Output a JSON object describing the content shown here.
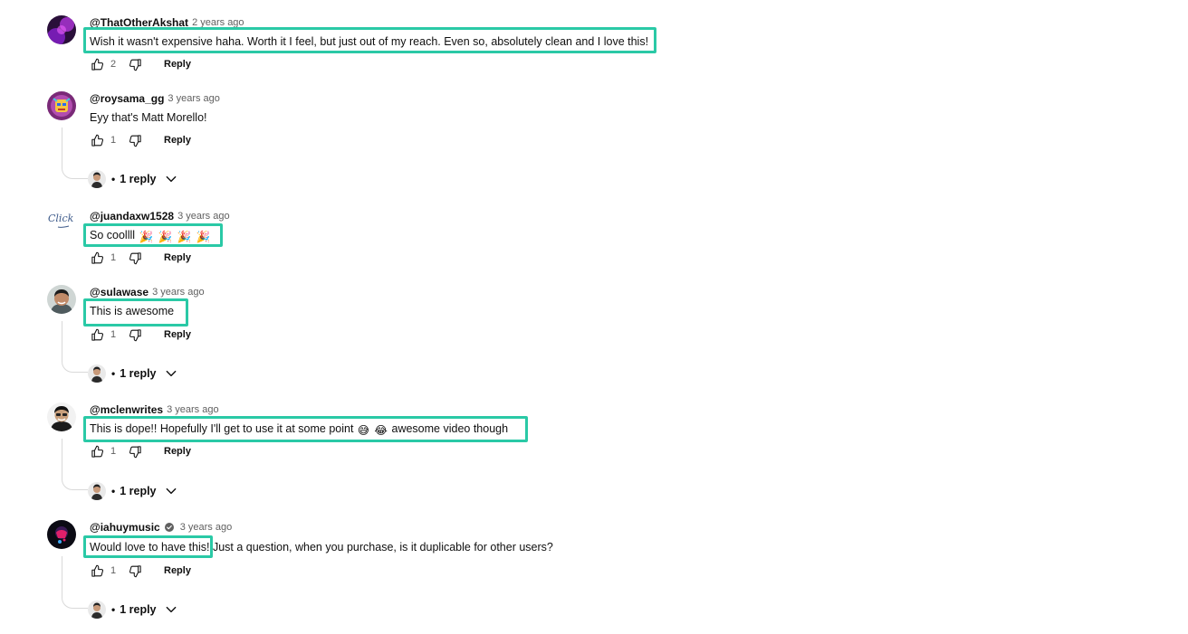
{
  "comments": [
    {
      "author": "@ThatOtherAkshat",
      "time": "2 years ago",
      "text": "Wish it wasn't expensive haha. Worth it I feel, but just out of my reach. Even so, absolutely clean and I love this!",
      "likes": "2",
      "reply_label": "Reply"
    },
    {
      "author": "@roysama_gg",
      "time": "3 years ago",
      "text": "Eyy that's Matt Morello!",
      "likes": "1",
      "reply_label": "Reply",
      "replies": "1 reply"
    },
    {
      "author": "@juandaxw1528",
      "time": "3 years ago",
      "text": "So coollll",
      "emojis": [
        "🎉",
        "🎉",
        "🎉",
        "🎉"
      ],
      "avatar_text": "Click Here!",
      "likes": "1",
      "reply_label": "Reply"
    },
    {
      "author": "@sulawase",
      "time": "3 years ago",
      "text": "This is awesome",
      "likes": "1",
      "reply_label": "Reply",
      "replies": "1 reply"
    },
    {
      "author": "@mclenwrites",
      "time": "3 years ago",
      "text_before": "This is dope!! Hopefully I'll get to use it at some point ",
      "emojis": [
        "😅",
        "😂"
      ],
      "text_after": " awesome video though",
      "likes": "1",
      "reply_label": "Reply",
      "replies": "1 reply"
    },
    {
      "author": "@iahuymusic",
      "time": "3 years ago",
      "verified": true,
      "text_highlight": "Would love to have this!",
      "text_rest": " Just a question, when you purchase, is it duplicable for other users?",
      "likes": "1",
      "reply_label": "Reply",
      "replies": "1 reply"
    }
  ],
  "separator": "•",
  "colors": {
    "highlight": "#2ac9a6",
    "text": "#0f0f0f",
    "muted": "#606060"
  }
}
